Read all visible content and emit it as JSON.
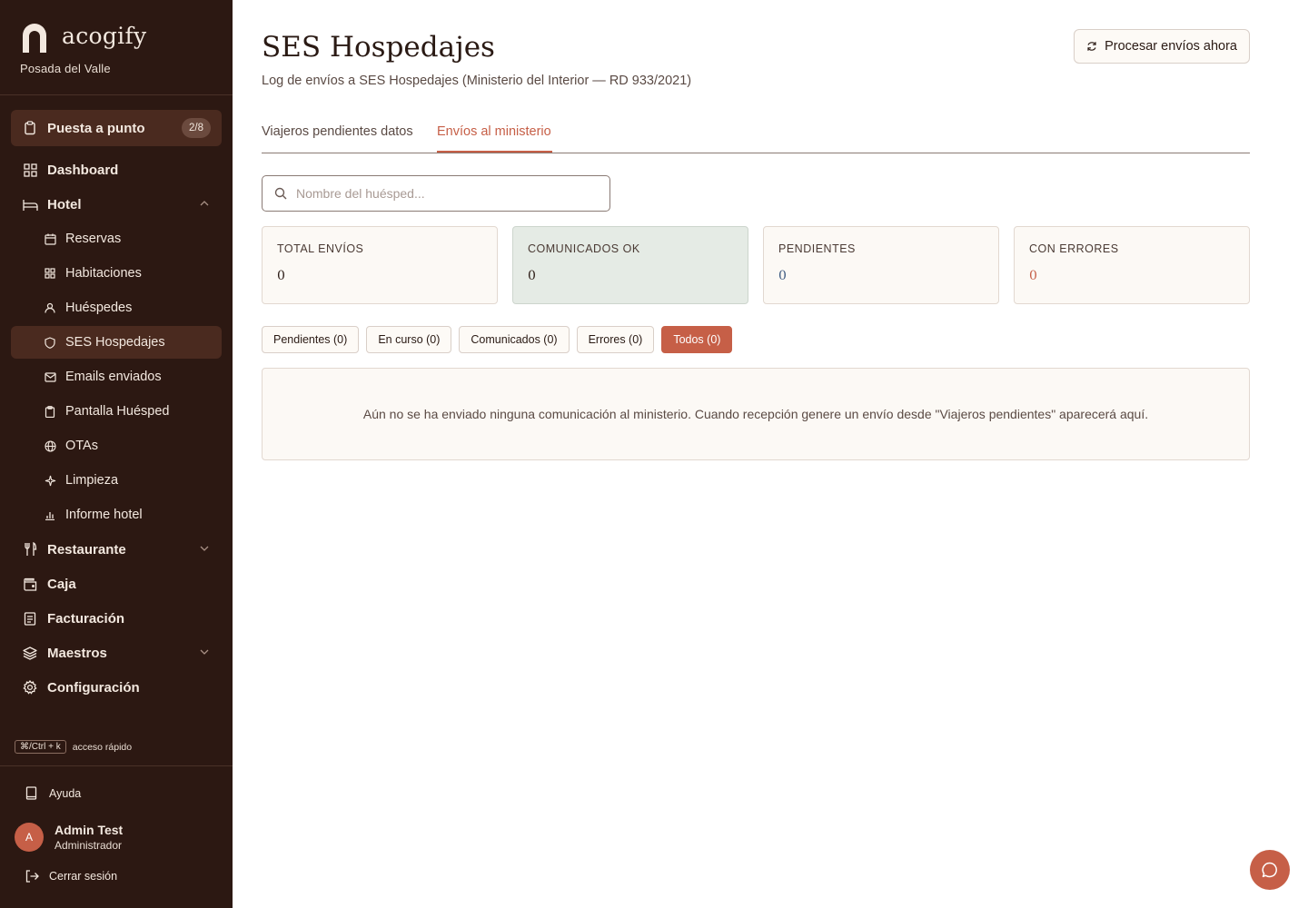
{
  "brand": {
    "name": "acogify",
    "property": "Posada del Valle"
  },
  "sidebar": {
    "setup": {
      "label": "Puesta a punto",
      "badge": "2/8",
      "icon": "clipboard-icon"
    },
    "items": [
      {
        "label": "Dashboard",
        "icon": "grid-icon"
      },
      {
        "label": "Hotel",
        "icon": "bed-icon"
      },
      {
        "label": "Reservas",
        "icon": "calendar-icon"
      },
      {
        "label": "Habitaciones",
        "icon": "grid-icon"
      },
      {
        "label": "Huéspedes",
        "icon": "user-icon"
      },
      {
        "label": "SES Hospedajes",
        "icon": "shield-icon"
      },
      {
        "label": "Emails enviados",
        "icon": "mail-icon"
      },
      {
        "label": "Pantalla Huésped",
        "icon": "clipboard-icon"
      },
      {
        "label": "OTAs",
        "icon": "globe-icon"
      },
      {
        "label": "Limpieza",
        "icon": "sparkle-icon"
      },
      {
        "label": "Informe hotel",
        "icon": "bar-chart-icon"
      },
      {
        "label": "Restaurante",
        "icon": "utensils-icon"
      },
      {
        "label": "Caja",
        "icon": "wallet-icon"
      },
      {
        "label": "Facturación",
        "icon": "receipt-icon"
      },
      {
        "label": "Maestros",
        "icon": "layers-icon"
      },
      {
        "label": "Configuración",
        "icon": "gear-icon"
      }
    ],
    "shortcut": {
      "keys": "⌘/Ctrl + k",
      "label": "acceso rápido"
    },
    "help": "Ayuda",
    "user": {
      "initial": "A",
      "name": "Admin Test",
      "role": "Administrador"
    },
    "logout": "Cerrar sesión"
  },
  "header": {
    "title": "SES Hospedajes",
    "subtitle": "Log de envíos a SES Hospedajes (Ministerio del Interior — RD 933/2021)",
    "process_button": "Procesar envíos ahora"
  },
  "tabs": [
    {
      "label": "Viajeros pendientes datos",
      "active": false
    },
    {
      "label": "Envíos al ministerio",
      "active": true
    }
  ],
  "search": {
    "placeholder": "Nombre del huésped...",
    "value": ""
  },
  "stats": [
    {
      "label": "TOTAL ENVÍOS",
      "value": "0",
      "color": "#2a1a14"
    },
    {
      "label": "COMUNICADOS OK",
      "value": "0",
      "color": "#2a1a14"
    },
    {
      "label": "PENDIENTES",
      "value": "0",
      "color": "#3d5a80"
    },
    {
      "label": "CON ERRORES",
      "value": "0",
      "color": "#c65f47"
    }
  ],
  "filters": [
    {
      "label": "Pendientes (0)",
      "active": false
    },
    {
      "label": "En curso (0)",
      "active": false
    },
    {
      "label": "Comunicados (0)",
      "active": false
    },
    {
      "label": "Errores (0)",
      "active": false
    },
    {
      "label": "Todos (0)",
      "active": true
    }
  ],
  "empty_message": "Aún no se ha enviado ninguna comunicación al ministerio. Cuando recepción genere un envío desde \"Viajeros pendientes\" aparecerá aquí.",
  "colors": {
    "sidebar_bg": "#2c1812",
    "accent": "#c65f47",
    "ok_bg": "#e5ebe5"
  }
}
